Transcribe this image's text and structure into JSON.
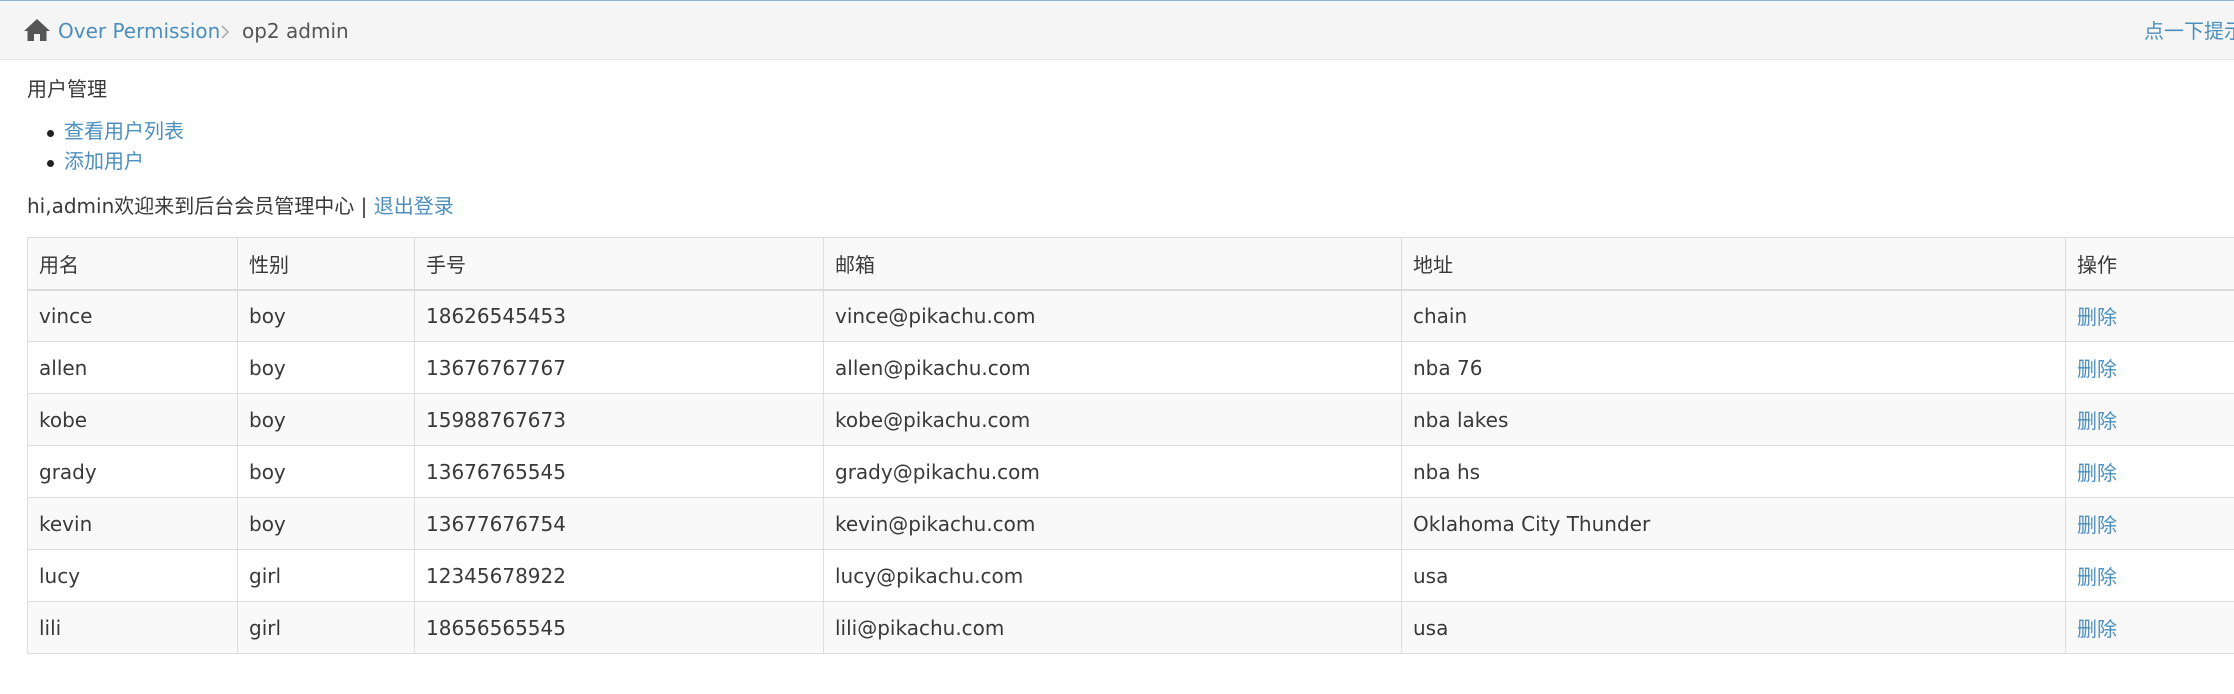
{
  "breadcrumb": {
    "home_icon": "home-icon",
    "link_label": "Over Permission",
    "separator_icon": "chevron-right-icon",
    "current_label": "op2 admin"
  },
  "hint_link_label": "点一下提示",
  "section_title": "用户管理",
  "menu": [
    {
      "label": "查看用户列表"
    },
    {
      "label": "添加用户"
    }
  ],
  "welcome": {
    "text": "hi,admin欢迎来到后台会员管理中心 | ",
    "logout_label": "退出登录"
  },
  "table": {
    "headers": [
      "用名",
      "性别",
      "手号",
      "邮箱",
      "地址",
      "操作"
    ],
    "rows": [
      [
        "vince",
        "boy",
        "18626545453",
        "vince@pikachu.com",
        "chain",
        "删除"
      ],
      [
        "allen",
        "boy",
        "13676767767",
        "allen@pikachu.com",
        "nba 76",
        "删除"
      ],
      [
        "kobe",
        "boy",
        "15988767673",
        "kobe@pikachu.com",
        "nba lakes",
        "删除"
      ],
      [
        "grady",
        "boy",
        "13676765545",
        "grady@pikachu.com",
        "nba hs",
        "删除"
      ],
      [
        "kevin",
        "boy",
        "13677676754",
        "kevin@pikachu.com",
        "Oklahoma City Thunder",
        "删除"
      ],
      [
        "lucy",
        "girl",
        "12345678922",
        "lucy@pikachu.com",
        "usa",
        "删除"
      ],
      [
        "lili",
        "girl",
        "18656565545",
        "lili@pikachu.com",
        "usa",
        "删除"
      ]
    ]
  },
  "colors": {
    "link": "#4c8fbd",
    "text": "#393939",
    "topbar_bg": "#f5f5f5",
    "stripe_bg": "#f9f9f9",
    "border": "#dddddd"
  }
}
